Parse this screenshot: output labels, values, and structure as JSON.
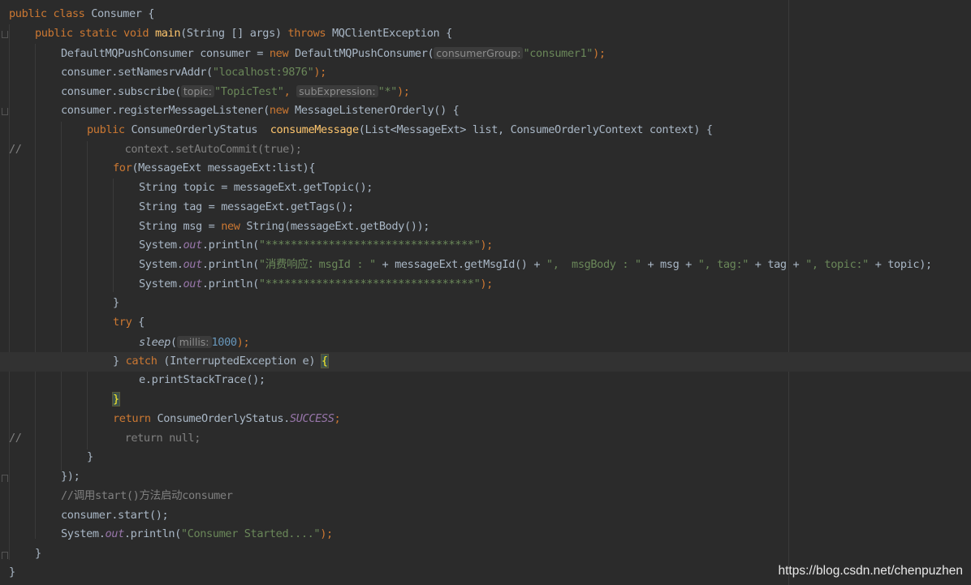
{
  "code": {
    "l1": {
      "kw1": "public",
      "kw2": "class",
      "name": "Consumer",
      "tail": " {"
    },
    "l2": {
      "kw1": "public",
      "kw2": "static",
      "kw3": "void",
      "fn": "main",
      "args": "(String [] args) ",
      "kw4": "throws",
      "tail": " MQClientException {"
    },
    "l3": {
      "pre": "DefaultMQPushConsumer consumer = ",
      "kw": "new",
      "mid": " DefaultMQPushConsumer(",
      "hint": "consumerGroup:",
      "str": "\"consumer1\"",
      "tail": ");"
    },
    "l4": {
      "pre": "consumer.setNamesrvAddr(",
      "str": "\"localhost:9876\"",
      "tail": ");"
    },
    "l5": {
      "pre": "consumer.subscribe(",
      "hint1": "topic:",
      "str1": "\"TopicTest\"",
      "comma": ", ",
      "hint2": "subExpression:",
      "str2": "\"*\"",
      "tail": ");"
    },
    "l6": {
      "pre": "consumer.registerMessageListener(",
      "kw": "new",
      "tail": " MessageListenerOrderly() {"
    },
    "l7": {
      "kw": "public",
      "mid": " ConsumeOrderlyStatus  ",
      "fn": "consumeMessage",
      "tail": "(List<MessageExt> list, ConsumeOrderlyContext context) {"
    },
    "l8": {
      "slash": "//",
      "body": "context.setAutoCommit(true);"
    },
    "l9": {
      "kw": "for",
      "tail": "(MessageExt messageExt:list){"
    },
    "l10": {
      "pre": "String topic = messageExt.getTopic();"
    },
    "l11": {
      "pre": "String tag = messageExt.getTags();"
    },
    "l12": {
      "pre": "String msg = ",
      "kw": "new",
      "tail": " String(messageExt.getBody());"
    },
    "l13": {
      "pre": "System.",
      "st": "out",
      "mid": ".println(",
      "str": "\"*********************************\"",
      "tail": ");"
    },
    "l14": {
      "pre": "System.",
      "st": "out",
      "mid": ".println(",
      "s1": "\"消费响应：msgId : \"",
      "p1": " + messageExt.getMsgId() + ",
      "s2": "\",  msgBody : \"",
      "p2": " + msg + ",
      "s3": "\", tag:\"",
      "p3": " + tag + ",
      "s4": "\", topic:\"",
      "tail": " + topic);"
    },
    "l15": {
      "pre": "System.",
      "st": "out",
      "mid": ".println(",
      "str": "\"*********************************\"",
      "tail": ");"
    },
    "l16": {
      "pre": "}"
    },
    "l17": {
      "kw": "try",
      "tail": " {"
    },
    "l18": {
      "fn": "sleep",
      "open": "(",
      "hint": "millis:",
      "num": "1000",
      "tail": ");"
    },
    "l19": {
      "pre": "} ",
      "kw": "catch",
      "mid": " (InterruptedException e) ",
      "brace": "{"
    },
    "l20": {
      "pre": "e.printStackTrace();"
    },
    "l21": {
      "brace": "}"
    },
    "l22": {
      "kw": "return",
      "mid": " ConsumeOrderlyStatus.",
      "st": "SUCCESS",
      "tail": ";"
    },
    "l23": {
      "slash": "//",
      "body": "return null;"
    },
    "l24": {
      "pre": "}"
    },
    "l25": {
      "pre": "});"
    },
    "l26": {
      "cm": "//调用start()方法启动consumer"
    },
    "l27": {
      "pre": "consumer.start();"
    },
    "l28": {
      "pre": "System.",
      "st": "out",
      "mid": ".println(",
      "str": "\"Consumer Started....\"",
      "tail": ");"
    },
    "l29": {
      "pre": "}"
    },
    "l30": {
      "pre": "}"
    }
  },
  "watermark": "https://blog.csdn.net/chenpuzhen"
}
